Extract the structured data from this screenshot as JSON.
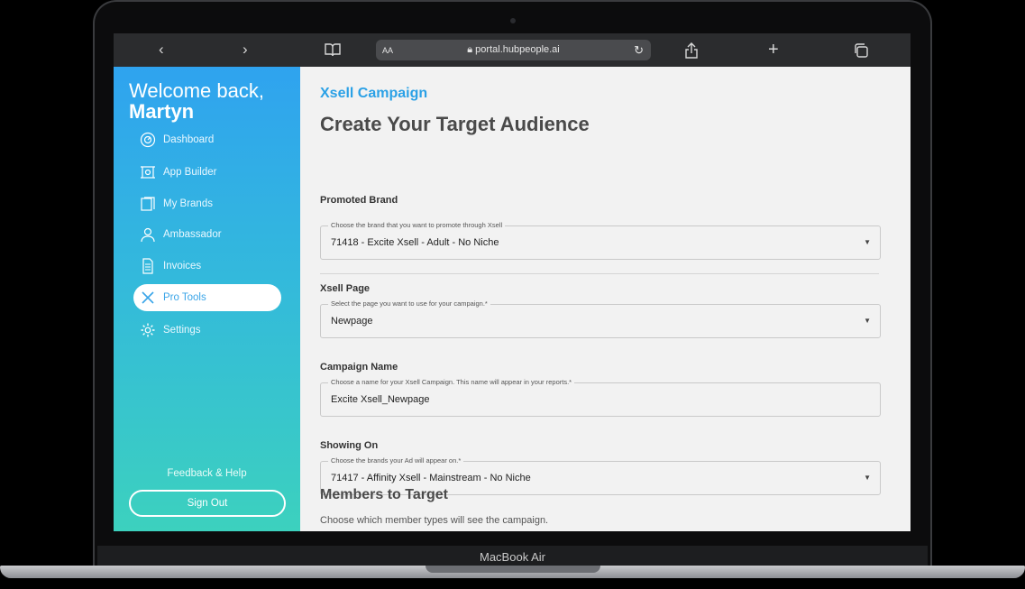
{
  "device": {
    "label": "MacBook Air"
  },
  "browser": {
    "text_size": "AA",
    "url": "portal.hubpeople.ai"
  },
  "sidebar": {
    "welcome": "Welcome back,",
    "user_name": "Martyn",
    "items": [
      {
        "label": "Dashboard"
      },
      {
        "label": "App Builder"
      },
      {
        "label": "My Brands"
      },
      {
        "label": "Ambassador"
      },
      {
        "label": "Invoices"
      },
      {
        "label": "Pro Tools",
        "active": true
      },
      {
        "label": "Settings"
      }
    ],
    "feedback": "Feedback & Help",
    "sign_out": "Sign Out"
  },
  "main": {
    "breadcrumb": "Xsell Campaign",
    "title": "Create Your Target Audience",
    "promoted_brand": {
      "label": "Promoted Brand",
      "legend": "Choose the brand that you want to promote through Xsell",
      "value": "71418 - Excite Xsell - Adult - No Niche"
    },
    "xsell_page": {
      "label": "Xsell Page",
      "legend": "Select the page you want to use for your campaign.*",
      "value": "Newpage"
    },
    "campaign_name": {
      "label": "Campaign Name",
      "legend": "Choose a name for your Xsell Campaign. This name will appear in your reports.*",
      "value": "Excite Xsell_Newpage"
    },
    "showing_on": {
      "label": "Showing On",
      "legend": "Choose the brands your Ad will appear on.*",
      "value": "71417 - Affinity Xsell - Mainstream - No Niche"
    },
    "members": {
      "title": "Members to Target",
      "description": "Choose which member types will see the campaign."
    }
  }
}
